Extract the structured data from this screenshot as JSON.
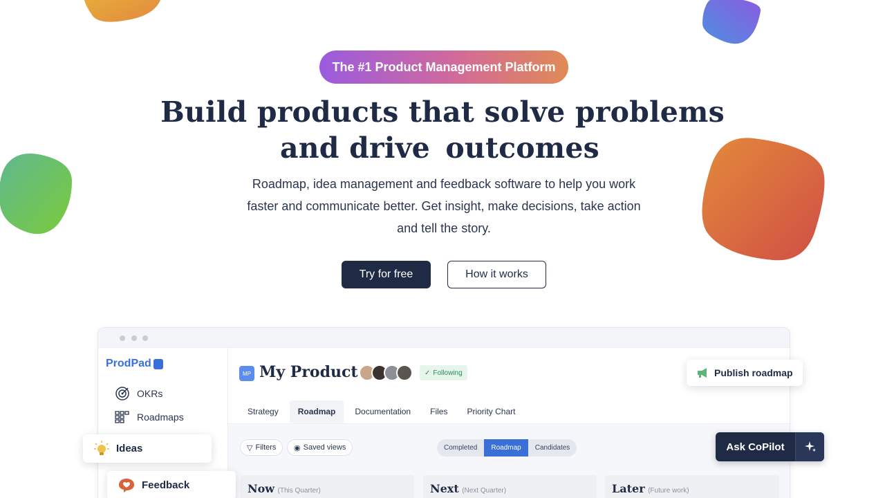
{
  "hero": {
    "badge": "The #1 Product Management Platform",
    "headline_line1": "Build products that solve problems",
    "headline_line2_prefix": "and drive",
    "headline_highlight": "outcomes",
    "subtitle": "Roadmap, idea management and feedback software to help you work faster and communicate better. Get insight, make decisions, take action and tell the story.",
    "primary_cta": "Try for free",
    "secondary_cta": "How it works"
  },
  "app": {
    "logo": "ProdPad",
    "sidebar": {
      "items": [
        {
          "label": "OKRs",
          "icon": "target-icon"
        },
        {
          "label": "Roadmaps",
          "icon": "grid-icon"
        }
      ]
    },
    "product": {
      "badge": "MP",
      "title": "My Product",
      "follow_label": "Following"
    },
    "tabs": [
      {
        "label": "Strategy",
        "active": false
      },
      {
        "label": "Roadmap",
        "active": true
      },
      {
        "label": "Documentation",
        "active": false
      },
      {
        "label": "Files",
        "active": false
      },
      {
        "label": "Priority Chart",
        "active": false
      }
    ],
    "toolbar": {
      "filters": "Filters",
      "saved_views": "Saved views",
      "segments": [
        "Completed",
        "Roadmap",
        "Candidates"
      ],
      "active_segment": "Roadmap"
    },
    "columns": [
      {
        "title": "Now",
        "subtitle": "(This Quarter)"
      },
      {
        "title": "Next",
        "subtitle": "(Next Quarter)"
      },
      {
        "title": "Later",
        "subtitle": "(Future work)"
      }
    ]
  },
  "floating": {
    "publish": "Publish roadmap",
    "ideas": "Ideas",
    "feedback": "Feedback",
    "copilot": "Ask CoPilot"
  },
  "colors": {
    "navy": "#1f2b45",
    "accent_blue": "#3a6fd8",
    "highlight": "#bcdff2"
  }
}
